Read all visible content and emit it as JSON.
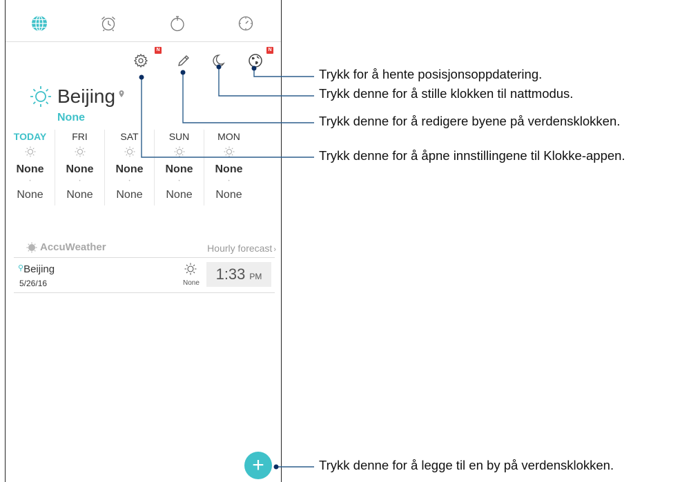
{
  "tabs": [
    {
      "name": "world-clock",
      "icon": "globe-icon"
    },
    {
      "name": "alarm",
      "icon": "alarm-clock-icon"
    },
    {
      "name": "stopwatch",
      "icon": "stopwatch-icon"
    },
    {
      "name": "timer",
      "icon": "timer-icon"
    }
  ],
  "actions": {
    "settings": {
      "icon": "gear-icon",
      "badge": "N"
    },
    "edit": {
      "icon": "pencil-icon"
    },
    "night_mode": {
      "icon": "moon-icon"
    },
    "location": {
      "icon": "globe-location-icon",
      "badge": "N"
    }
  },
  "weather": {
    "city": "Beijing",
    "condition": "None",
    "days": [
      {
        "name": "TODAY",
        "high": "None",
        "low": "None"
      },
      {
        "name": "FRI",
        "high": "None",
        "low": "None"
      },
      {
        "name": "SAT",
        "high": "None",
        "low": "None"
      },
      {
        "name": "SUN",
        "high": "None",
        "low": "None"
      },
      {
        "name": "MON",
        "high": "None",
        "low": "None"
      }
    ],
    "provider": "AccuWeather",
    "hourly_link": "Hourly forecast"
  },
  "world_clock": {
    "city": "Beijing",
    "date": "5/26/16",
    "condition": "None",
    "time": "1:33",
    "ampm": "PM"
  },
  "callouts": {
    "location": "Trykk for å hente posisjonsoppdatering.",
    "night_mode": "Trykk denne for å stille klokken til nattmodus.",
    "edit": "Trykk denne for å redigere byene på verdensklokken.",
    "settings": "Trykk denne for å åpne innstillingene til Klokke-appen.",
    "add": "Trykk denne for å legge til en by på verdensklokken."
  },
  "colors": {
    "accent": "#3fc1c9",
    "badge": "#e53935"
  }
}
